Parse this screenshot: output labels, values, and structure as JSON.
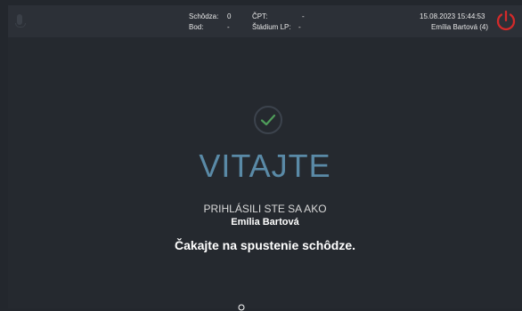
{
  "topbar": {
    "left_labels": {
      "schodza": "Schôdza:",
      "bod": "Bod:"
    },
    "left_values": {
      "schodza": "0",
      "bod": "-"
    },
    "mid_labels": {
      "cpt": "ČPT:",
      "stadium": "Štádium LP:"
    },
    "mid_values": {
      "cpt": "-",
      "stadium": "-"
    },
    "datetime": "15.08.2023 15:44:53",
    "user": "Emília Bartová (4)"
  },
  "main": {
    "title": "VITAJTE",
    "subtitle": "PRIHLÁSILI STE SA AKO",
    "user_name": "Emília Bartová",
    "waiting": "Čakajte na spustenie schôdze."
  },
  "colors": {
    "background": "#25292f",
    "accent_blue": "#5a8aa7",
    "check_green": "#4f9d5a",
    "power_red": "#d32a2a"
  },
  "icons": [
    "microphone-icon",
    "power-icon",
    "check-icon",
    "hand-icon"
  ]
}
